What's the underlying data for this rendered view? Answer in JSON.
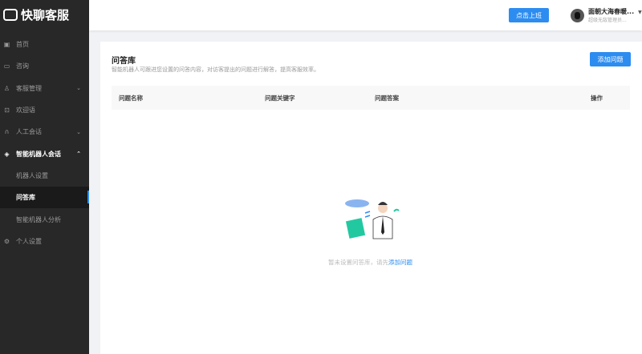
{
  "app": {
    "name": "快聊客服"
  },
  "sidebar": {
    "items": [
      {
        "label": "首页",
        "icon": "home-icon"
      },
      {
        "label": "咨询",
        "icon": "chat-icon"
      },
      {
        "label": "客服管理",
        "icon": "users-icon",
        "chevron": "down"
      },
      {
        "label": "欢迎语",
        "icon": "welcome-icon"
      },
      {
        "label": "人工会话",
        "icon": "headset-icon",
        "chevron": "down"
      },
      {
        "label": "智能机器人会话",
        "icon": "robot-icon",
        "chevron": "up",
        "sub": [
          {
            "label": "机器人设置"
          },
          {
            "label": "问答库",
            "active": true
          },
          {
            "label": "智能机器人分析"
          }
        ]
      },
      {
        "label": "个人设置",
        "icon": "gear-icon"
      }
    ]
  },
  "header": {
    "clock_in_label": "点击上班",
    "user_name": "面朝大海春暖...",
    "user_role": "超级无敌管理员..."
  },
  "main": {
    "title": "问答库",
    "description": "智能机器人可跟进您设置的问答内容，对访客提出的问题进行解答，提高客服效率。",
    "add_label": "添加问题",
    "columns": [
      "问题名称",
      "问题关键字",
      "问题答案",
      "操作"
    ],
    "empty_text": "暂未设置问答库，请先",
    "empty_link": "添加问题"
  },
  "colors": {
    "accent": "#2d8cf0",
    "sidebar": "#282828"
  }
}
